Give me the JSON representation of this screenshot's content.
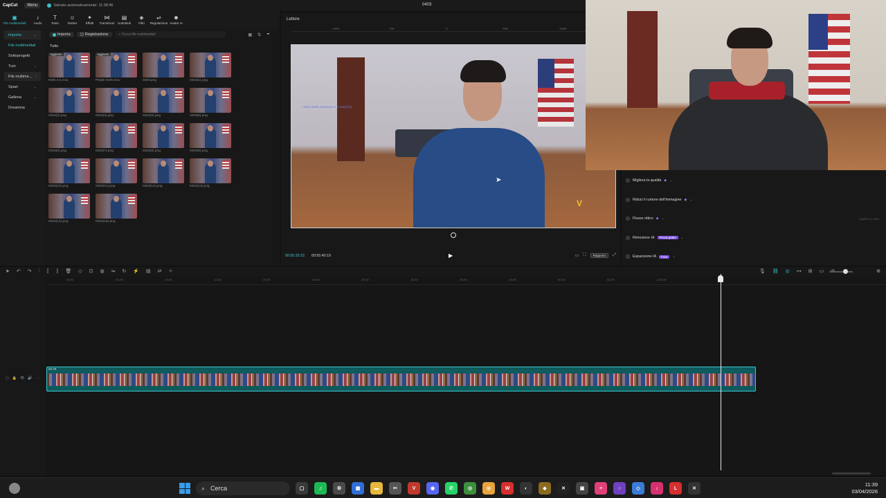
{
  "app": {
    "logo": "CapCut",
    "menu_label": "Menu",
    "autosave_text": "Salvato automaticamente: 11:38:46",
    "window_title": "0403"
  },
  "toolbar": {
    "tools": [
      {
        "icon": "media-icon",
        "glyph": "▣",
        "label": "File multimediali",
        "active": true
      },
      {
        "icon": "audio-icon",
        "glyph": "♪",
        "label": "Audio"
      },
      {
        "icon": "text-icon",
        "glyph": "T",
        "label": "Testo"
      },
      {
        "icon": "sticker-icon",
        "glyph": "☺",
        "label": "Sticker"
      },
      {
        "icon": "effects-icon",
        "glyph": "✦",
        "label": "Effetti"
      },
      {
        "icon": "transitions-icon",
        "glyph": "⋈",
        "label": "Transizioni"
      },
      {
        "icon": "subtitles-icon",
        "glyph": "▤",
        "label": "Sottotitoli"
      },
      {
        "icon": "filters-icon",
        "glyph": "◈",
        "label": "Filtri"
      },
      {
        "icon": "adjust-icon",
        "glyph": "⇌",
        "label": "Regolazione"
      },
      {
        "icon": "avatar-icon",
        "glyph": "☻",
        "label": "Avatar IA"
      }
    ]
  },
  "leftnav": {
    "items": [
      {
        "label": "Importa",
        "active": true,
        "chev": "⌄",
        "highlight": true
      },
      {
        "label": "File multimediali",
        "active": true
      },
      {
        "label": "Sottoprogetti"
      },
      {
        "label": "Tuoi",
        "chev": "⌄"
      },
      {
        "label": "File multime...",
        "chev": "›",
        "highlight": true
      },
      {
        "label": "Spazi",
        "chev": "⌄"
      },
      {
        "label": "Galleria",
        "chev": "⌄"
      },
      {
        "label": "Dreamina"
      }
    ]
  },
  "library": {
    "import_label": "Importa",
    "record_label": "Registrazione",
    "search_placeholder": "Cerca file multimediali",
    "section_label": "Tutto",
    "view_icons": [
      "▦",
      "⇅",
      "⏷"
    ],
    "files": [
      {
        "name": "NNN 2.5.mov",
        "badge": "Aggiunto"
      },
      {
        "name": "PDQE NNN.mov",
        "badge": "Aggiunto"
      },
      {
        "name": "0403.png"
      },
      {
        "name": "0403(1).png"
      },
      {
        "name": "0403(2).png"
      },
      {
        "name": "0403(3).png"
      },
      {
        "name": "0403(4).png"
      },
      {
        "name": "0403(5).png"
      },
      {
        "name": "0403(6).png"
      },
      {
        "name": "0403(7).png"
      },
      {
        "name": "0403(8).png"
      },
      {
        "name": "0403(9).png"
      },
      {
        "name": "0403(10).png"
      },
      {
        "name": "0403(11).png"
      },
      {
        "name": "0403(12).png"
      },
      {
        "name": "0403(13).png"
      },
      {
        "name": "0403(14).png"
      },
      {
        "name": "0403(15).png"
      }
    ]
  },
  "player": {
    "title": "Lettore",
    "ruler_labels": [
      "1400",
      "700",
      "0",
      "700",
      "1400"
    ],
    "overlay_text": "... inizio della sessione è 4 ore(s) fa",
    "current_time": "00:55:33:22",
    "total_time": "00:55:40:19",
    "ratio_label": "Rapporto"
  },
  "right_panel": {
    "rows": [
      {
        "label": "Migliora la qualità",
        "icon": "◆"
      },
      {
        "label": "Riduci il rumore dell'immagine",
        "icon": "◆"
      },
      {
        "label": "Flusso ottico",
        "icon": "◆",
        "extra": "Applica a tutto"
      },
      {
        "label": "Rimozione IA",
        "tag": "Prova gratis"
      },
      {
        "label": "Espansione IA",
        "tag": "Free"
      }
    ]
  },
  "timeline": {
    "clip_duration": "55:38",
    "ticks": [
      "00:00",
      "05:00",
      "10:00",
      "15:00",
      "20:00",
      "25:00",
      "30:00",
      "35:00",
      "40:00",
      "45:00",
      "50:00",
      "55:00",
      "1:00:00"
    ]
  },
  "taskbar": {
    "search_label": "Cerca",
    "time": "11:39",
    "date": "03/04/2026",
    "apps": [
      {
        "name": "task-view-icon",
        "color": "#3a3a3a",
        "glyph": "▢"
      },
      {
        "name": "spotify-icon",
        "color": "#1db954",
        "glyph": "♫"
      },
      {
        "name": "settings-icon",
        "color": "#4a4a4a",
        "glyph": "⚙"
      },
      {
        "name": "store-icon",
        "color": "#2f6fd6",
        "glyph": "▦"
      },
      {
        "name": "explorer-icon",
        "color": "#e8b83a",
        "glyph": "▬"
      },
      {
        "name": "snipping-icon",
        "color": "#555555",
        "glyph": "✂"
      },
      {
        "name": "voicemeeter-icon",
        "color": "#c0392b",
        "glyph": "V"
      },
      {
        "name": "discord-icon",
        "color": "#5865f2",
        "glyph": "◉"
      },
      {
        "name": "whatsapp-icon",
        "color": "#25d366",
        "glyph": "✆"
      },
      {
        "name": "chrome-icon",
        "color": "#3d8f3d",
        "glyph": "◎"
      },
      {
        "name": "chrome-alt-icon",
        "color": "#e8a33a",
        "glyph": "◎"
      },
      {
        "name": "wps-icon",
        "color": "#d62f2f",
        "glyph": "W"
      },
      {
        "name": "obs-icon",
        "color": "#333333",
        "glyph": "◐"
      },
      {
        "name": "app-icon",
        "color": "#8a6b20",
        "glyph": "◆"
      },
      {
        "name": "capcut-icon",
        "color": "#222222",
        "glyph": "✕"
      },
      {
        "name": "photo-icon",
        "color": "#444444",
        "glyph": "▣"
      },
      {
        "name": "pink-app-icon",
        "color": "#e0407a",
        "glyph": "≡"
      },
      {
        "name": "circle-app-icon",
        "color": "#7040c0",
        "glyph": "○"
      },
      {
        "name": "blue-app-icon",
        "color": "#3a7bd5",
        "glyph": "◇"
      },
      {
        "name": "tiktok-icon",
        "color": "#d6306e",
        "glyph": "♪"
      },
      {
        "name": "l-app-icon",
        "color": "#d62f2f",
        "glyph": "L"
      },
      {
        "name": "capcut-active-icon",
        "color": "#333333",
        "glyph": "✕"
      }
    ]
  }
}
